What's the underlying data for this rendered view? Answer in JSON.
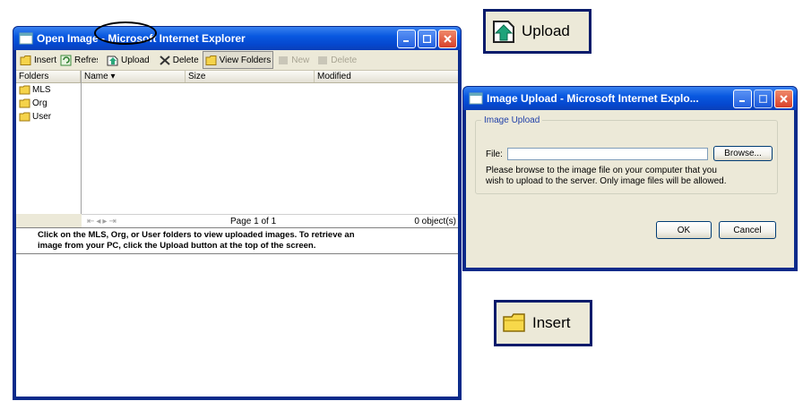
{
  "main_window": {
    "title": "Open Image - Microsoft Internet Explorer",
    "toolbar": {
      "insert": "Insert",
      "refresh": "Refresh",
      "upload": "Upload",
      "delete": "Delete",
      "view_folders": "View Folders",
      "new": "New",
      "delete2": "Delete"
    },
    "folders_header": "Folders",
    "folders": [
      "MLS",
      "Org",
      "User"
    ],
    "columns": {
      "name": "Name",
      "size": "Size",
      "modified": "Modified"
    },
    "pager": {
      "page_text": "Page 1 of 1",
      "count": "0 object(s)"
    },
    "instruction_line1": "Click on the MLS, Org, or User folders to view uploaded images.  To retrieve an",
    "instruction_line2": "image from your PC, click the Upload button at the top of the screen."
  },
  "upload_dialog": {
    "title": "Image Upload - Microsoft Internet Explo...",
    "group_label": "Image Upload",
    "file_label": "File:",
    "file_value": "",
    "browse_label": "Browse...",
    "help_line1": "Please browse to the image file on your computer that you",
    "help_line2": "wish to upload to the server. Only image files will be allowed.",
    "ok_label": "OK",
    "cancel_label": "Cancel"
  },
  "callouts": {
    "upload_label": "Upload",
    "insert_label": "Insert"
  },
  "colors": {
    "xp_title_blue": "#0548cf",
    "window_face": "#ece9d8",
    "callout_border": "#071b6b"
  }
}
